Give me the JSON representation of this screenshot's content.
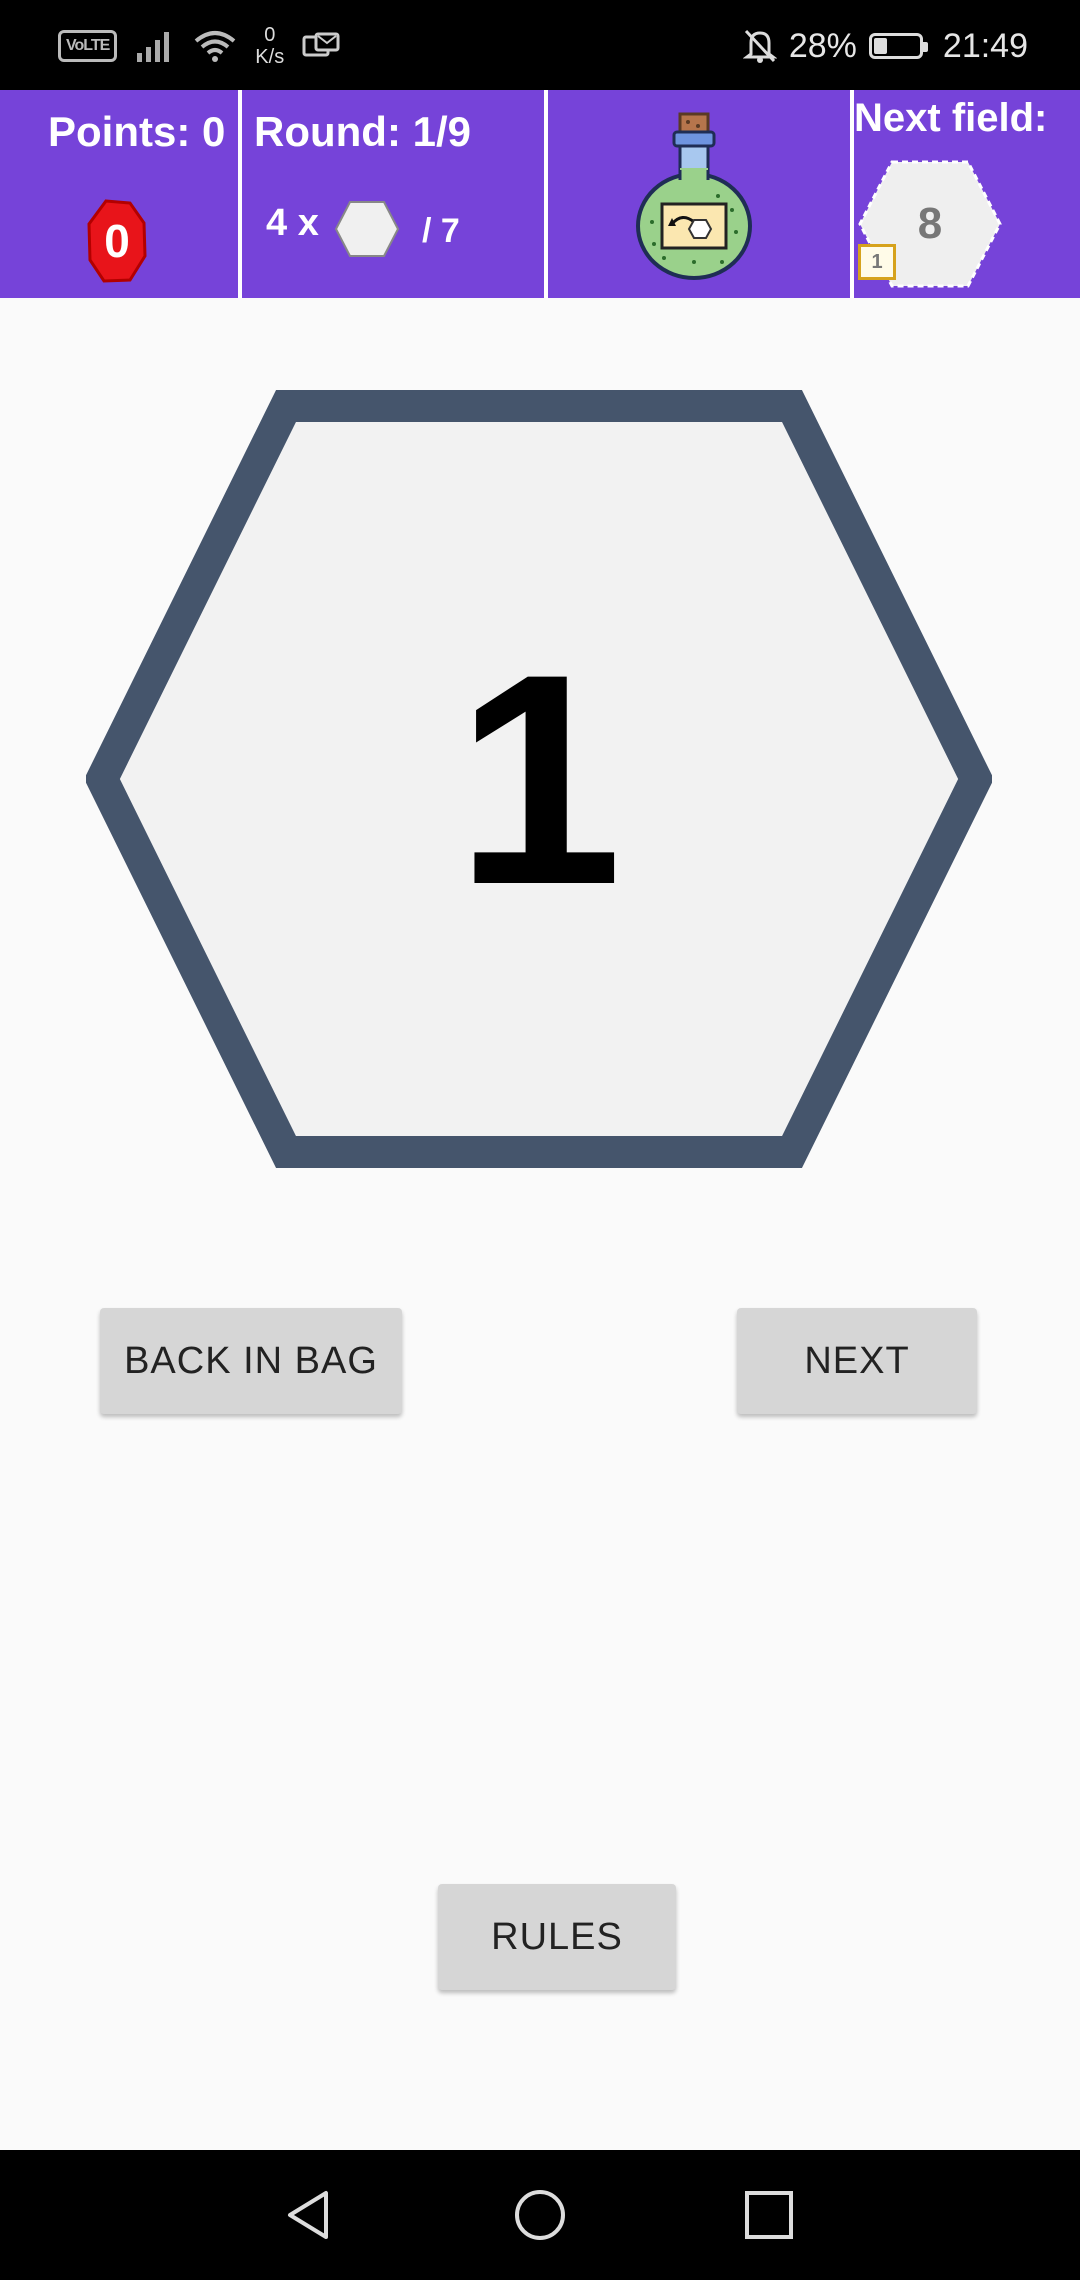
{
  "status_bar": {
    "volte_label": "VoLTE",
    "net_speed_value": "0",
    "net_speed_unit": "K/s",
    "battery_percent": "28%",
    "battery_level": 0.28,
    "time": "21:49"
  },
  "header": {
    "points_label": "Points: 0",
    "points_badge_value": "0",
    "round_label": "Round: 1/9",
    "count_prefix": "4 x",
    "count_suffix": "/ 7",
    "next_field_label": "Next field:",
    "next_field_value": "8",
    "next_field_badge": "1"
  },
  "board": {
    "current_value": "1"
  },
  "buttons": {
    "back_in_bag": "BACK IN BAG",
    "next": "NEXT",
    "rules": "RULES"
  },
  "colors": {
    "header_bg": "#7643d9",
    "hex_border": "#45556c",
    "hex_fill": "#f2f2f2",
    "points_badge": "#e8141a",
    "button_bg": "#d6d6d6"
  }
}
